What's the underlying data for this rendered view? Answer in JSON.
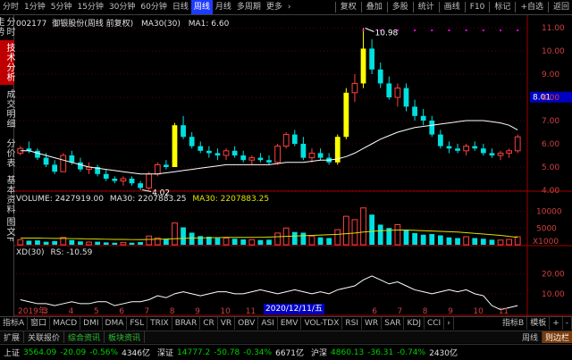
{
  "toolbar": {
    "periods": [
      "分时",
      "1分钟",
      "5分钟",
      "15分钟",
      "30分钟",
      "60分钟",
      "日线",
      "周线",
      "月线",
      "多周期",
      "更多"
    ],
    "active_period": "周线",
    "more_arrow": "›",
    "actions": [
      "复权",
      "叠加",
      "多股",
      "统计",
      "画线",
      "F10",
      "标记",
      "+自选",
      "返回"
    ]
  },
  "sidebar": {
    "tabs": [
      "分时走势",
      "技术分析",
      "成交明细",
      "分价表",
      "基本资料"
    ],
    "active": "技术分析"
  },
  "header": {
    "code": "002177",
    "name": "御银股份(周线 前复权)",
    "ma_label": "MA30(30)",
    "ma1_label": "MA1: 6.60"
  },
  "price_axis": {
    "ticks": [
      "11.00",
      "10.00",
      "9.00",
      "8.00",
      "7.00",
      "6.00",
      "5.00",
      "4.00"
    ],
    "current": "8.01",
    "high_label": "10.98",
    "low_label": "4.02"
  },
  "volume": {
    "label": "VOLUME: 2427919.00",
    "ma30_label": "MA30: 2207883.25",
    "ma30b_label": "MA30: 2207883.25",
    "ticks": [
      "10000",
      "5000"
    ],
    "unit": "X1000",
    "zero_label": "10",
    "side_text": "图文F"
  },
  "xd": {
    "label": "XD(30)",
    "rs_label": "RS: -10.59",
    "ticks": [
      "20.00",
      "10.00"
    ]
  },
  "time_axis": {
    "labels": [
      "2019年",
      "3",
      "4",
      "5",
      "6",
      "7",
      "8",
      "9",
      "10",
      "11",
      "12",
      "3",
      "4",
      "5",
      "6",
      "7",
      "8",
      "9",
      "10",
      "11"
    ],
    "cursor_date": "2020/12/11/五"
  },
  "indicators": {
    "tabs": [
      "指标A",
      "窗口",
      "MACD",
      "DMI",
      "DMA",
      "FSL",
      "TRIX",
      "BRAR",
      "CR",
      "VR",
      "OBV",
      "ASI",
      "EMV",
      "VOL-TDX",
      "RSI",
      "WR",
      "SAR",
      "KDJ",
      "CCI"
    ],
    "more": "›",
    "right": [
      "指标B",
      "模板",
      "+",
      "-"
    ]
  },
  "ext": {
    "tabs": [
      "扩展",
      "关联报价",
      "综合资讯",
      "板块资讯"
    ],
    "period_btn": "周线",
    "corner": "则边栏"
  },
  "status": {
    "sh_name": "上证",
    "sh_price": "3564.09",
    "sh_chg": "-20.09",
    "sh_pct": "-0.56%",
    "sh_amt": "4346亿",
    "sz_name": "深证",
    "sz_price": "14777.2",
    "sz_chg": "-50.78",
    "sz_pct": "-0.34%",
    "sz_amt": "6671亿",
    "hs_name": "沪深",
    "hs_price": "4860.13",
    "hs_chg": "-36.31",
    "hs_pct": "-0.74%",
    "hs_amt": "2430亿"
  },
  "colors": {
    "up": "#ff4040",
    "down": "#00e0e0",
    "ma": "#ffffff",
    "highlight": "#ffff00",
    "accent": "#1e3cff"
  },
  "chart_data": [
    {
      "type": "candlestick",
      "title": "御银股份(周线 前复权)",
      "ylim": [
        4.0,
        11.0
      ],
      "candles": [
        [
          5.6,
          5.9,
          5.5,
          5.8
        ],
        [
          5.8,
          6.1,
          5.6,
          5.7
        ],
        [
          5.7,
          5.8,
          5.3,
          5.4
        ],
        [
          5.4,
          5.6,
          5.0,
          5.1
        ],
        [
          5.1,
          5.3,
          4.7,
          4.8
        ],
        [
          4.8,
          5.6,
          4.8,
          5.5
        ],
        [
          5.5,
          5.7,
          5.1,
          5.2
        ],
        [
          5.2,
          5.4,
          4.8,
          4.9
        ],
        [
          4.9,
          5.2,
          4.7,
          5.0
        ],
        [
          5.0,
          5.1,
          4.6,
          4.7
        ],
        [
          4.7,
          4.9,
          4.4,
          4.5
        ],
        [
          4.5,
          4.6,
          4.3,
          4.4
        ],
        [
          4.4,
          4.6,
          4.2,
          4.5
        ],
        [
          4.5,
          4.6,
          4.2,
          4.3
        ],
        [
          4.3,
          4.4,
          4.0,
          4.1
        ],
        [
          4.1,
          4.8,
          4.02,
          4.7
        ],
        [
          4.7,
          5.2,
          4.6,
          5.1
        ],
        [
          5.1,
          5.3,
          4.9,
          5.0
        ],
        [
          5.0,
          6.9,
          5.0,
          6.8
        ],
        [
          6.8,
          7.2,
          6.2,
          6.3
        ],
        [
          6.3,
          6.5,
          5.8,
          5.9
        ],
        [
          5.9,
          6.1,
          5.6,
          5.7
        ],
        [
          5.7,
          5.9,
          5.4,
          5.6
        ],
        [
          5.6,
          5.8,
          5.3,
          5.5
        ],
        [
          5.5,
          5.8,
          5.3,
          5.7
        ],
        [
          5.7,
          5.9,
          5.4,
          5.5
        ],
        [
          5.5,
          5.7,
          5.2,
          5.3
        ],
        [
          5.3,
          5.5,
          5.1,
          5.4
        ],
        [
          5.4,
          5.6,
          5.2,
          5.3
        ],
        [
          5.3,
          5.5,
          5.1,
          5.2
        ],
        [
          5.2,
          6.0,
          5.1,
          5.9
        ],
        [
          5.9,
          6.5,
          5.8,
          6.4
        ],
        [
          6.4,
          6.6,
          5.9,
          6.0
        ],
        [
          6.0,
          6.3,
          5.3,
          5.4
        ],
        [
          5.4,
          5.8,
          5.2,
          5.6
        ],
        [
          5.6,
          5.8,
          5.3,
          5.4
        ],
        [
          5.4,
          5.6,
          5.1,
          5.2
        ],
        [
          5.2,
          6.4,
          5.1,
          6.3
        ],
        [
          6.3,
          8.4,
          6.2,
          8.2
        ],
        [
          8.2,
          9.0,
          7.8,
          8.6
        ],
        [
          8.6,
          10.98,
          8.4,
          10.1
        ],
        [
          10.1,
          10.5,
          9.0,
          9.2
        ],
        [
          9.2,
          9.5,
          8.4,
          8.6
        ],
        [
          8.6,
          8.9,
          7.9,
          8.0
        ],
        [
          8.0,
          8.6,
          7.6,
          8.4
        ],
        [
          8.4,
          8.6,
          7.4,
          7.6
        ],
        [
          7.6,
          7.9,
          7.0,
          7.2
        ],
        [
          7.2,
          7.5,
          6.8,
          7.0
        ],
        [
          7.0,
          7.2,
          6.3,
          6.4
        ],
        [
          6.4,
          6.6,
          5.8,
          5.9
        ],
        [
          5.9,
          6.1,
          5.6,
          5.8
        ],
        [
          5.8,
          6.0,
          5.6,
          5.7
        ],
        [
          5.7,
          6.0,
          5.5,
          5.9
        ],
        [
          5.9,
          6.1,
          5.7,
          5.8
        ],
        [
          5.8,
          6.0,
          5.5,
          5.6
        ],
        [
          5.6,
          5.8,
          5.4,
          5.5
        ],
        [
          5.5,
          5.7,
          5.3,
          5.6
        ],
        [
          5.6,
          5.8,
          5.4,
          5.7
        ],
        [
          5.7,
          6.4,
          5.6,
          6.3
        ]
      ],
      "ma30": [
        5.7,
        5.7,
        5.6,
        5.5,
        5.4,
        5.3,
        5.2,
        5.1,
        5.0,
        4.95,
        4.9,
        4.85,
        4.8,
        4.75,
        4.7,
        4.7,
        4.7,
        4.75,
        4.8,
        4.85,
        4.9,
        4.95,
        5.0,
        5.05,
        5.1,
        5.1,
        5.1,
        5.1,
        5.1,
        5.1,
        5.15,
        5.2,
        5.2,
        5.2,
        5.25,
        5.3,
        5.3,
        5.35,
        5.45,
        5.6,
        5.8,
        6.0,
        6.2,
        6.35,
        6.5,
        6.6,
        6.7,
        6.75,
        6.8,
        6.85,
        6.9,
        6.95,
        7.0,
        7.0,
        7.0,
        6.95,
        6.9,
        6.8,
        6.6
      ]
    },
    {
      "type": "bar",
      "title": "VOLUME",
      "ylim": [
        0,
        12000
      ],
      "values": [
        1500,
        1200,
        1300,
        900,
        1100,
        2200,
        1400,
        1000,
        800,
        900,
        700,
        600,
        700,
        600,
        800,
        2600,
        2000,
        1600,
        6500,
        5200,
        3600,
        2600,
        2400,
        2000,
        2000,
        1800,
        1600,
        1500,
        1400,
        1500,
        3500,
        5000,
        3800,
        3600,
        2600,
        2200,
        2000,
        4500,
        8500,
        7500,
        11000,
        9000,
        6000,
        5000,
        6000,
        4500,
        3500,
        3000,
        3200,
        2800,
        2200,
        2000,
        2400,
        2000,
        1800,
        1500,
        1400,
        1600,
        2400
      ],
      "ma30": [
        2000,
        2000,
        2000,
        1950,
        1900,
        1900,
        1850,
        1800,
        1750,
        1700,
        1650,
        1600,
        1600,
        1550,
        1550,
        1600,
        1650,
        1700,
        1800,
        1900,
        2000,
        2050,
        2100,
        2150,
        2200,
        2200,
        2200,
        2200,
        2250,
        2300,
        2400,
        2500,
        2600,
        2700,
        2800,
        2900,
        3000,
        3100,
        3300,
        3500,
        3800,
        4000,
        4200,
        4300,
        4400,
        4400,
        4300,
        4200,
        4100,
        4000,
        3900,
        3800,
        3600,
        3400,
        3200,
        3000,
        2800,
        2500,
        2200
      ]
    },
    {
      "type": "line",
      "title": "XD(30)",
      "ylim": [
        0,
        28
      ],
      "values": [
        7,
        6,
        5,
        5,
        4,
        5,
        6,
        5,
        5,
        6,
        6,
        4,
        5,
        6,
        6,
        7,
        9,
        8,
        10,
        11,
        10,
        9,
        10,
        11,
        11,
        10,
        10,
        11,
        12,
        11,
        10,
        11,
        12,
        11,
        10,
        11,
        10,
        12,
        13,
        14,
        17,
        19,
        17,
        15,
        16,
        14,
        12,
        11,
        10,
        11,
        12,
        11,
        12,
        10,
        9,
        4,
        2,
        3,
        4
      ]
    }
  ]
}
